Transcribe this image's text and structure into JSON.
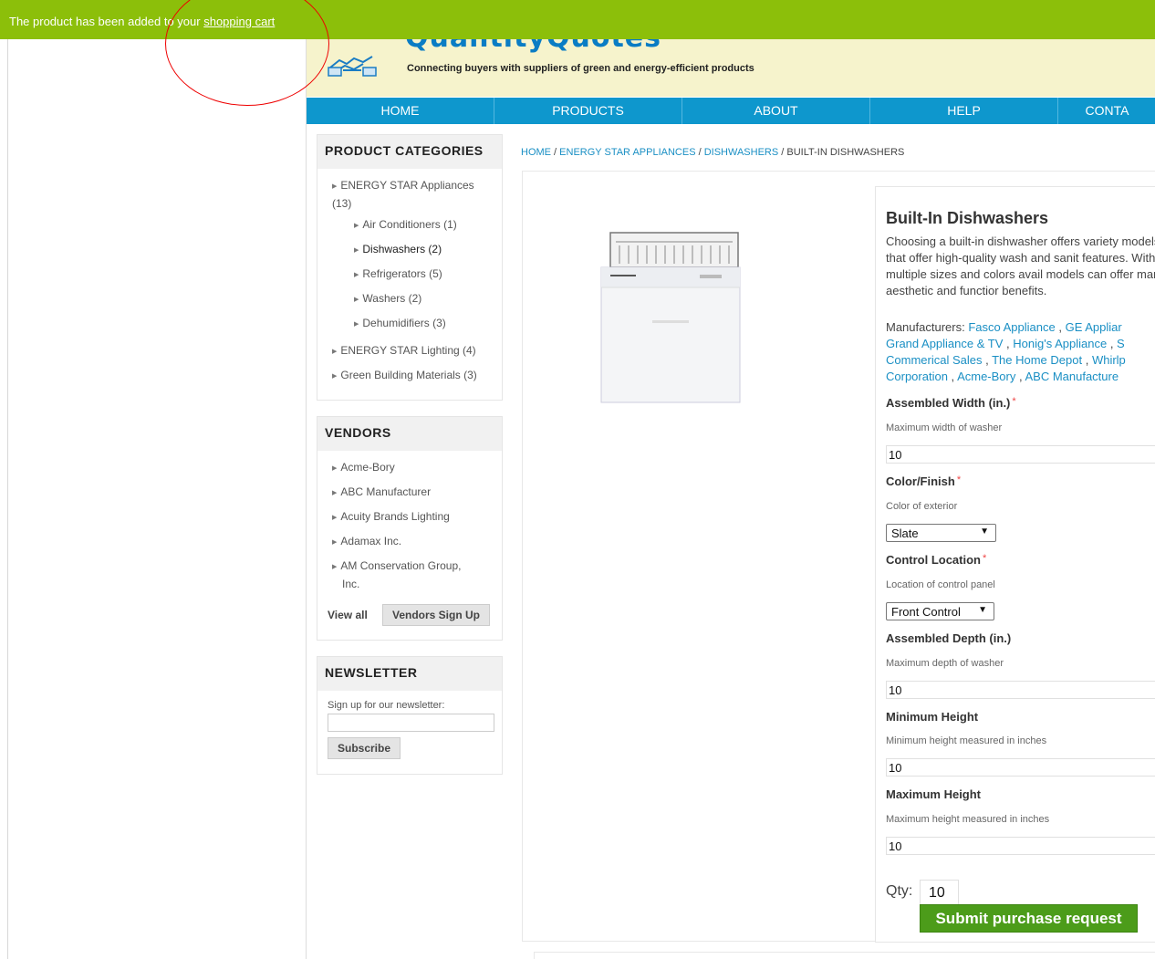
{
  "notification": {
    "text": "The product has been added to your",
    "link": "shopping cart"
  },
  "header": {
    "logo_text": "QuantityQuotes",
    "tagline": "Connecting buyers with suppliers of green and energy-efficient products"
  },
  "nav": {
    "items": [
      "HOME",
      "PRODUCTS",
      "ABOUT",
      "HELP",
      "CONTA"
    ]
  },
  "sidebar": {
    "categories_title": "PRODUCT CATEGORIES",
    "categories": [
      {
        "label": "ENERGY STAR Appliances",
        "count": "(13)"
      },
      {
        "label": "Air Conditioners (1)"
      },
      {
        "label": "Dishwashers (2)"
      },
      {
        "label": "Refrigerators (5)"
      },
      {
        "label": "Washers (2)"
      },
      {
        "label": "Dehumidifiers (3)"
      },
      {
        "label": "ENERGY STAR Lighting (4)"
      },
      {
        "label": "Green Building Materials (3)"
      }
    ],
    "vendors_title": "VENDORS",
    "vendors": [
      "Acme-Bory",
      "ABC Manufacturer",
      "Acuity Brands Lighting",
      "Adamax Inc.",
      "AM Conservation Group,",
      "Inc."
    ],
    "view_all": "View all",
    "vendors_signup": "Vendors Sign Up",
    "newsletter_title": "NEWSLETTER",
    "newsletter_prompt": "Sign up for our newsletter:",
    "newsletter_placeholder": "",
    "subscribe": "Subscribe"
  },
  "breadcrumb": {
    "home": "HOME",
    "sep": " / ",
    "appliances": "ENERGY STAR APPLIANCES",
    "dishwashers": "DISHWASHERS",
    "current": "BUILT-IN DISHWASHERS"
  },
  "product": {
    "title": "Built-In Dishwashers",
    "description": "Choosing a built-in dishwasher offers variety models that offer high-quality wash and sanit features. With multiple sizes and colors avail models can offer many aesthetic and functior benefits.",
    "manufacturers_label": "Manufacturers:",
    "manufacturers": [
      "Fasco Appliance",
      "GE Appliar",
      "Grand Appliance & TV",
      "Honig's Appliance",
      "S",
      "Commerical Sales",
      "The Home Depot",
      "Whirlp",
      "Corporation",
      "Acme-Bory",
      "ABC Manufacture"
    ]
  },
  "form": {
    "width_label": "Assembled Width (in.)",
    "width_help": "Maximum width of washer",
    "width_value": "10",
    "color_label": "Color/Finish",
    "color_help": "Color of exterior",
    "color_value": "Slate",
    "control_label": "Control Location",
    "control_help": "Location of control panel",
    "control_value": "Front Control",
    "depth_label": "Assembled Depth (in.)",
    "depth_help": "Maximum depth of washer",
    "depth_value": "10",
    "minh_label": "Minimum Height",
    "minh_help": "Minimum height measured in inches",
    "minh_value": "10",
    "maxh_label": "Maximum Height",
    "maxh_help": "Maximum height measured in inches",
    "maxh_value": "10",
    "required_mark": "*",
    "qty_label": "Qty:",
    "qty_value": "10",
    "submit": "Submit purchase request"
  },
  "colors": {
    "notice_bg": "#8cbf0a",
    "nav_bg": "#0e97cd",
    "header_bg": "#f6f3cc",
    "link": "#1a8fc4",
    "submit_bg": "#4c9c1a"
  }
}
